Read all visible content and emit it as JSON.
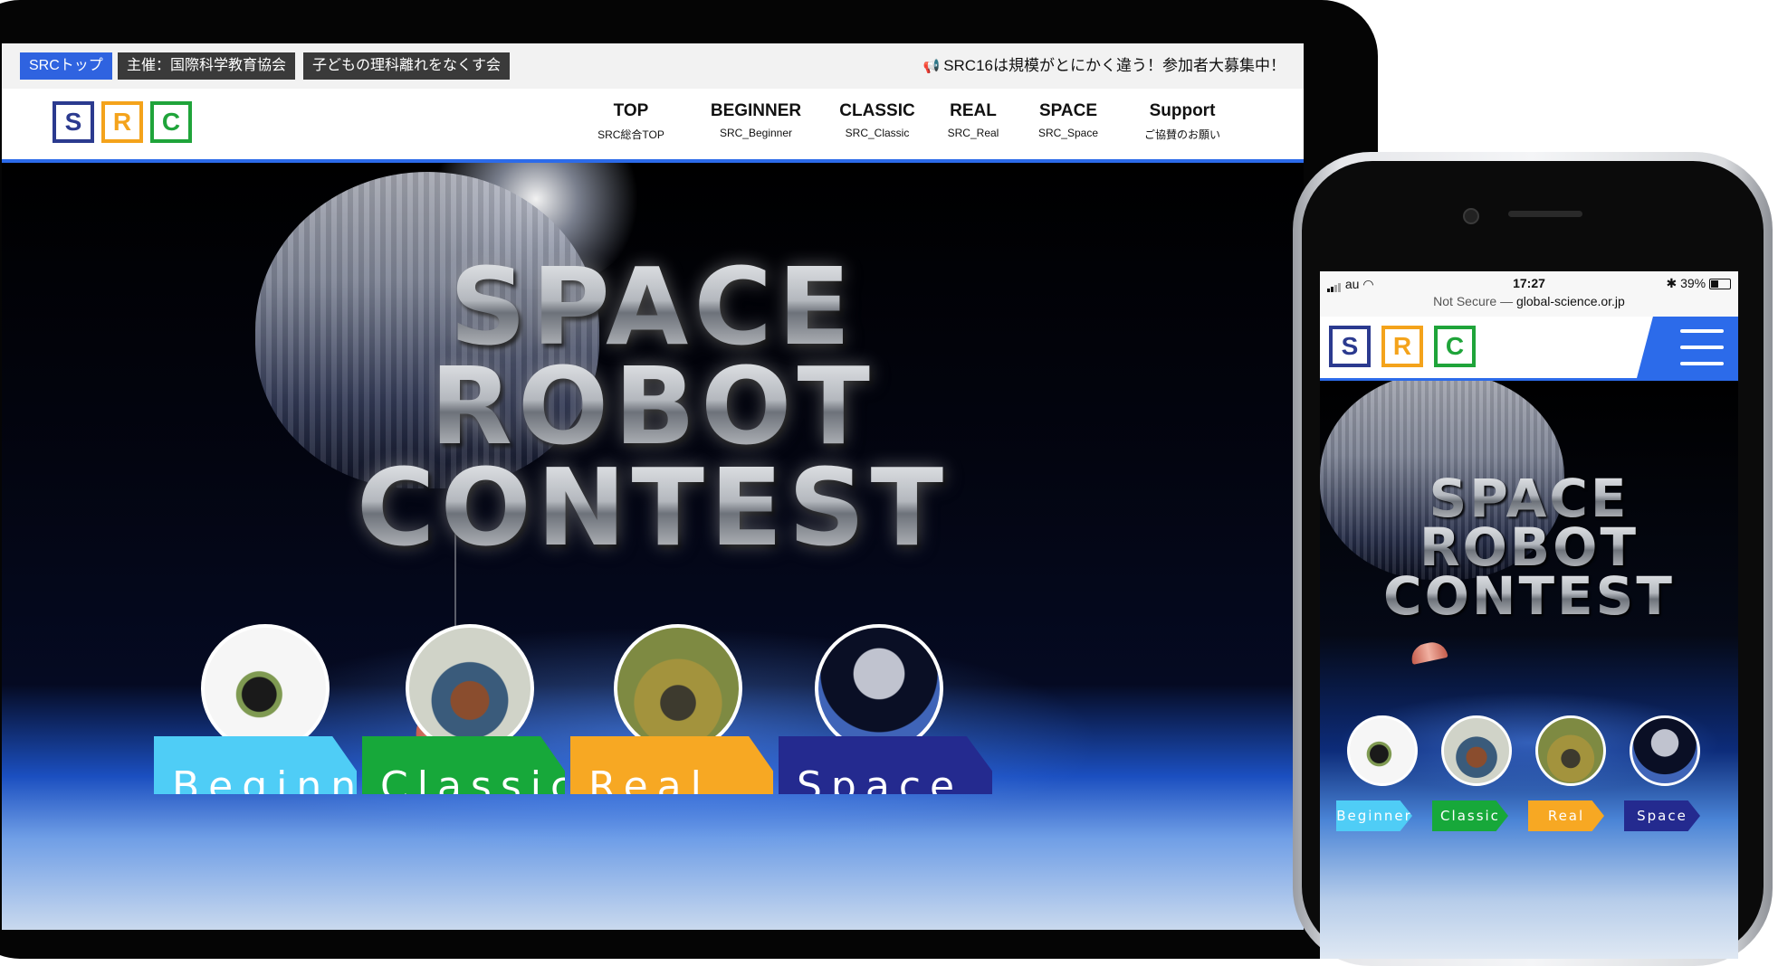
{
  "tablet": {
    "topbar": {
      "pill_home": "SRCトップ",
      "pill_organizer": "主催：国際科学教育協会",
      "pill_mission": "子どもの理科離れをなくす会",
      "announcement": "SRC16は規模がとにかく違う！参加者大募集中！"
    },
    "logo": {
      "letters": [
        "S",
        "R",
        "C"
      ],
      "colors": [
        "#2b3a8f",
        "#f4a31b",
        "#1fa43a"
      ]
    },
    "nav": [
      {
        "main": "TOP",
        "sub": "SRC総合TOP",
        "active": true
      },
      {
        "main": "BEGINNER",
        "sub": "SRC_Beginner",
        "active": false
      },
      {
        "main": "CLASSIC",
        "sub": "SRC_Classic",
        "active": false
      },
      {
        "main": "REAL",
        "sub": "SRC_Real",
        "active": false
      },
      {
        "main": "SPACE",
        "sub": "SRC_Space",
        "active": false
      },
      {
        "main": "Support",
        "sub": "ご協賛のお願い",
        "active": false
      }
    ],
    "hero_title": [
      "SPACE",
      "ROBOT",
      "CONTEST"
    ],
    "categories": [
      {
        "label": "Beginner",
        "color": "#4fcdf6"
      },
      {
        "label": "Classic",
        "color": "#17a83a"
      },
      {
        "label": "Real",
        "color": "#f7a823"
      },
      {
        "label": "Space",
        "color": "#242a8f"
      }
    ]
  },
  "phone": {
    "status": {
      "carrier": "au",
      "time": "17:27",
      "battery": "39%",
      "url_prefix": "Not Secure — ",
      "url_domain": "global-science.or.jp"
    },
    "hero_title": [
      "SPACE",
      "ROBOT",
      "CONTEST"
    ],
    "categories": [
      {
        "label": "Beginner",
        "color": "#4fcdf6"
      },
      {
        "label": "Classic",
        "color": "#17a83a"
      },
      {
        "label": "Real",
        "color": "#f7a823"
      },
      {
        "label": "Space",
        "color": "#242a8f"
      }
    ]
  },
  "colors": {
    "accent": "#2c6bea",
    "pill_blue": "#2f63e0",
    "pill_dark": "#3a3a3a"
  }
}
